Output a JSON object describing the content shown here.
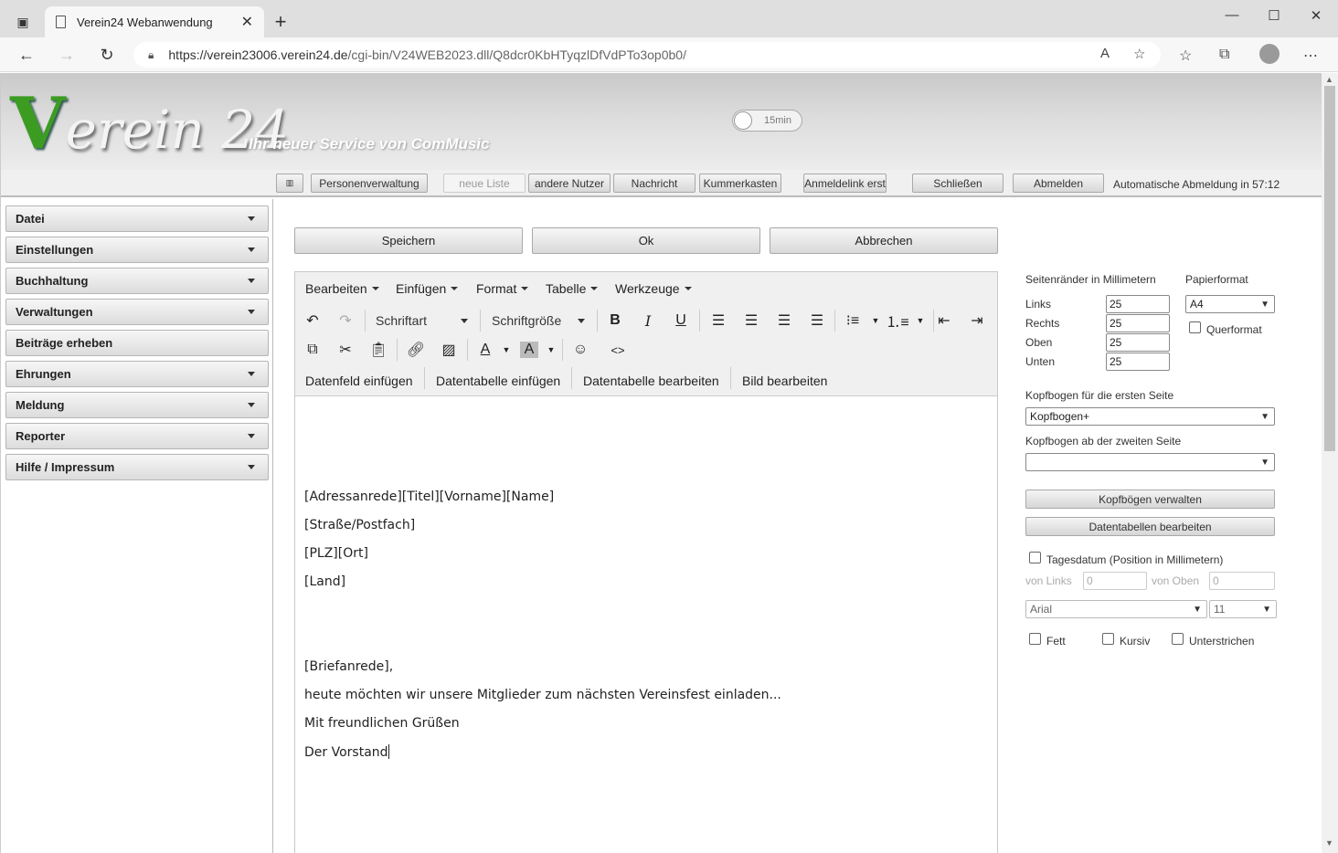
{
  "browser": {
    "tab_title": "Verein24 Webanwendung",
    "url_host": "https://verein23006.verein24.de",
    "url_path": "/cgi-bin/V24WEB2023.dll/Q8dcr0KbHTyqzlDfVdPTo3op0b0/"
  },
  "header": {
    "logo_v": "V",
    "logo_rest": "erein 24",
    "slogan": "Ihr neuer Service von ComMusic",
    "timer_toggle": "15min"
  },
  "topbar": {
    "buttons": [
      "Personenverwaltung",
      "neue Liste",
      "andere Nutzer",
      "Nachricht",
      "Kummerkasten",
      "Anmeldelink erst",
      "Schließen",
      "Abmelden"
    ],
    "auto_logout": "Automatische Abmeldung in 57:12"
  },
  "sidebar": {
    "items": [
      "Datei",
      "Einstellungen",
      "Buchhaltung",
      "Verwaltungen",
      "Beiträge erheben",
      "Ehrungen",
      "Meldung",
      "Reporter",
      "Hilfe / Impressum"
    ]
  },
  "actions": {
    "save": "Speichern",
    "ok": "Ok",
    "cancel": "Abbrechen"
  },
  "editor": {
    "menus": [
      "Bearbeiten",
      "Einfügen",
      "Format",
      "Tabelle",
      "Werkzeuge"
    ],
    "font_select": "Schriftart",
    "size_select": "Schriftgröße",
    "bold": "B",
    "italic": "I",
    "underline": "U",
    "datafield_buttons": [
      "Datenfeld einfügen",
      "Datentabelle einfügen",
      "Datentabelle bearbeiten",
      "Bild bearbeiten"
    ],
    "content_lines": [
      "[Adressanrede][Titel][Vorname][Name]",
      "[Straße/Postfach]",
      "[PLZ][Ort]",
      "[Land]",
      "[Briefanrede],",
      "heute möchten wir unsere Mitglieder zum nächsten Vereinsfest einladen...",
      "Mit freundlichen Grüßen",
      "Der Vorstand"
    ]
  },
  "settings": {
    "margins_title": "Seitenränder in Millimetern",
    "paper_title": "Papierformat",
    "margins": [
      {
        "label": "Links",
        "value": "25"
      },
      {
        "label": "Rechts",
        "value": "25"
      },
      {
        "label": "Oben",
        "value": "25"
      },
      {
        "label": "Unten",
        "value": "25"
      }
    ],
    "paper_format": "A4",
    "landscape_label": "Querformat",
    "letterhead_first_label": "Kopfbogen für die ersten Seite",
    "letterhead_first_value": "Kopfbogen+",
    "letterhead_second_label": "Kopfbogen ab der zweiten Seite",
    "letterhead_second_value": "",
    "manage_letterheads": "Kopfbögen verwalten",
    "edit_datatables": "Datentabellen bearbeiten",
    "date_label": "Tagesdatum (Position in Millimetern)",
    "from_left_label": "von Links",
    "from_left_value": "0",
    "from_top_label": "von Oben",
    "from_top_value": "0",
    "font_family": "Arial",
    "font_size": "11",
    "bold_label": "Fett",
    "italic_label": "Kursiv",
    "underline_label": "Unterstrichen"
  }
}
